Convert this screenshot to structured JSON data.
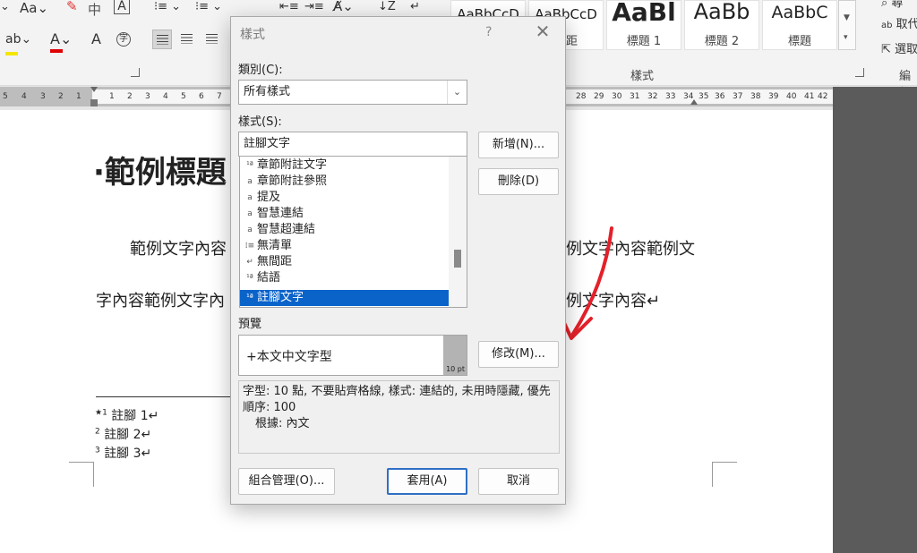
{
  "ribbon": {
    "font_group": {
      "case_label": "Aa",
      "zhuyin_label": "中",
      "outline_label": "A",
      "clear_label": "A",
      "circle_label": "字"
    },
    "styles_gallery": [
      {
        "sample": "AaBbCcD",
        "name": ""
      },
      {
        "sample": "AaBbCcD",
        "name": "間距"
      },
      {
        "sample": "AaBl",
        "name": "標題 1"
      },
      {
        "sample": "AaBb",
        "name": "標題 2"
      },
      {
        "sample": "AaBbC",
        "name": "標題"
      }
    ],
    "styles_group_label": "樣式",
    "editing": {
      "find": "尋",
      "replace": "取代",
      "select": "選取",
      "group_label": "編輯"
    }
  },
  "ruler": {
    "left_ticks": [
      "5",
      "4",
      "3",
      "2",
      "1"
    ],
    "ticks_a": [
      "1",
      "2",
      "3",
      "4",
      "5",
      "6",
      "7"
    ],
    "ticks_b": [
      "28",
      "29",
      "30",
      "31",
      "32",
      "33",
      "34",
      "35",
      "36",
      "37",
      "38",
      "39",
      "40",
      "41",
      "42"
    ]
  },
  "document": {
    "heading": "·範例標題",
    "line1_left": "範例文字內容",
    "line1_right": "例文字內容範例文",
    "line2_left": "字內容範例文字內",
    "line2_right": "例文字內容↵",
    "footnotes": [
      {
        "num": "★1",
        "text": "註腳 1↵"
      },
      {
        "num": "2",
        "text": "註腳 2↵"
      },
      {
        "num": "3",
        "text": "註腳 3↵"
      }
    ]
  },
  "dialog": {
    "title": "樣式",
    "help": "?",
    "close": "✕",
    "category_label": "類別(C):",
    "category_value": "所有樣式",
    "style_label": "樣式(S):",
    "style_value": "註腳文字",
    "list_items": [
      {
        "icon": "¹ª",
        "label": "章節附註文字",
        "selected": false
      },
      {
        "icon": "a",
        "label": "章節附註參照",
        "selected": false
      },
      {
        "icon": "a",
        "label": "提及",
        "selected": false
      },
      {
        "icon": "a",
        "label": "智慧連結",
        "selected": false
      },
      {
        "icon": "a",
        "label": "智慧超連結",
        "selected": false
      },
      {
        "icon": "⁞≡",
        "label": "無清單",
        "selected": false
      },
      {
        "icon": "↵",
        "label": "無間距",
        "selected": false
      },
      {
        "icon": "¹ª",
        "label": "結語",
        "selected": false
      },
      {
        "icon": "¹ª",
        "label": "註腳文字",
        "selected": true
      }
    ],
    "new_button": "新增(N)...",
    "delete_button": "刪除(D)",
    "preview_label": "預覽",
    "preview_sample": "+本文中文字型",
    "preview_size": "10 pt",
    "modify_button": "修改(M)...",
    "description": "字型: 10 點, 不要貼齊格線, 樣式: 連結的, 未用時隱藏, 優先順序: 100",
    "based_on": "根據: 內文",
    "organizer_button": "組合管理(O)...",
    "apply_button": "套用(A)",
    "cancel_button": "取消"
  },
  "colors": {
    "selection": "#0a63c9",
    "annotation_arrow": "#e4202a",
    "default_button_border": "#2f6fc4",
    "highlight_yellow": "#f5e600",
    "font_color_red": "#e00000"
  }
}
